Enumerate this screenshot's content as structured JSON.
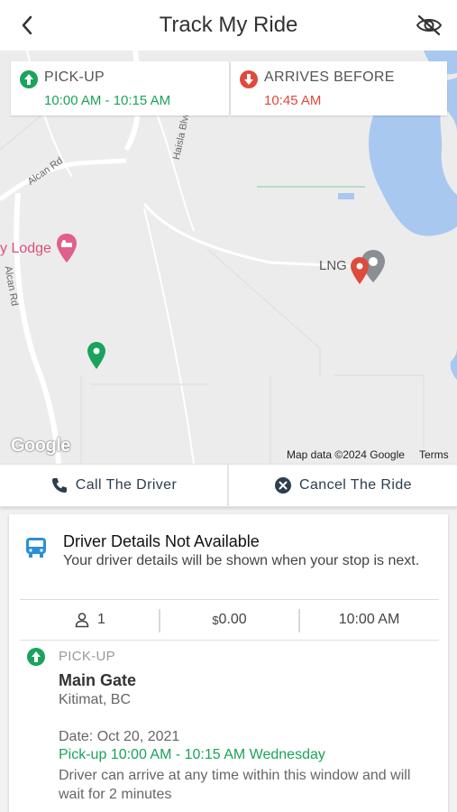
{
  "header": {
    "title": "Track My Ride",
    "icons": {
      "back": "chevron-left-icon",
      "visibility": "eye-off-icon"
    }
  },
  "map": {
    "pickup": {
      "label": "PICK-UP",
      "time": "10:00 AM - 10:15 AM",
      "color": "#1aa35b",
      "icon": "arrow-up-circle-icon"
    },
    "arrival": {
      "label": "ARRIVES BEFORE",
      "time": "10:45 AM",
      "color": "#e04a3b",
      "icon": "arrow-down-circle-icon"
    },
    "roads": [
      "Alcan Rd",
      "Alcan Rd",
      "Haisla Blvd"
    ],
    "places": {
      "lodge": "y Lodge",
      "lng": "LNG"
    },
    "attribution": {
      "logo": "Google",
      "map_data": "Map data ©2024 Google",
      "terms": "Terms"
    },
    "colors": {
      "water": "#a8c8f0",
      "land": "#ececec",
      "road": "#ffffff"
    }
  },
  "actions": {
    "call": {
      "label": "Call The Driver",
      "icon": "phone-icon"
    },
    "cancel": {
      "label": "Cancel The Ride",
      "icon": "close-circle-icon"
    }
  },
  "driver": {
    "title": "Driver Details Not Available",
    "subtitle": "Your driver details will be shown when your stop is next.",
    "icon": "bus-icon"
  },
  "stats": {
    "passengers": "1",
    "fare_symbol": "$",
    "fare": "0.00",
    "time": "10:00 AM",
    "passenger_icon": "person-icon"
  },
  "stop": {
    "label": "PICK-UP",
    "name": "Main Gate",
    "city": "Kitimat, BC",
    "date": "Date: Oct 20, 2021",
    "window": "Pick-up 10:00 AM - 10:15 AM Wednesday",
    "note": "Driver can arrive at any time within this window and will wait for 2 minutes"
  }
}
